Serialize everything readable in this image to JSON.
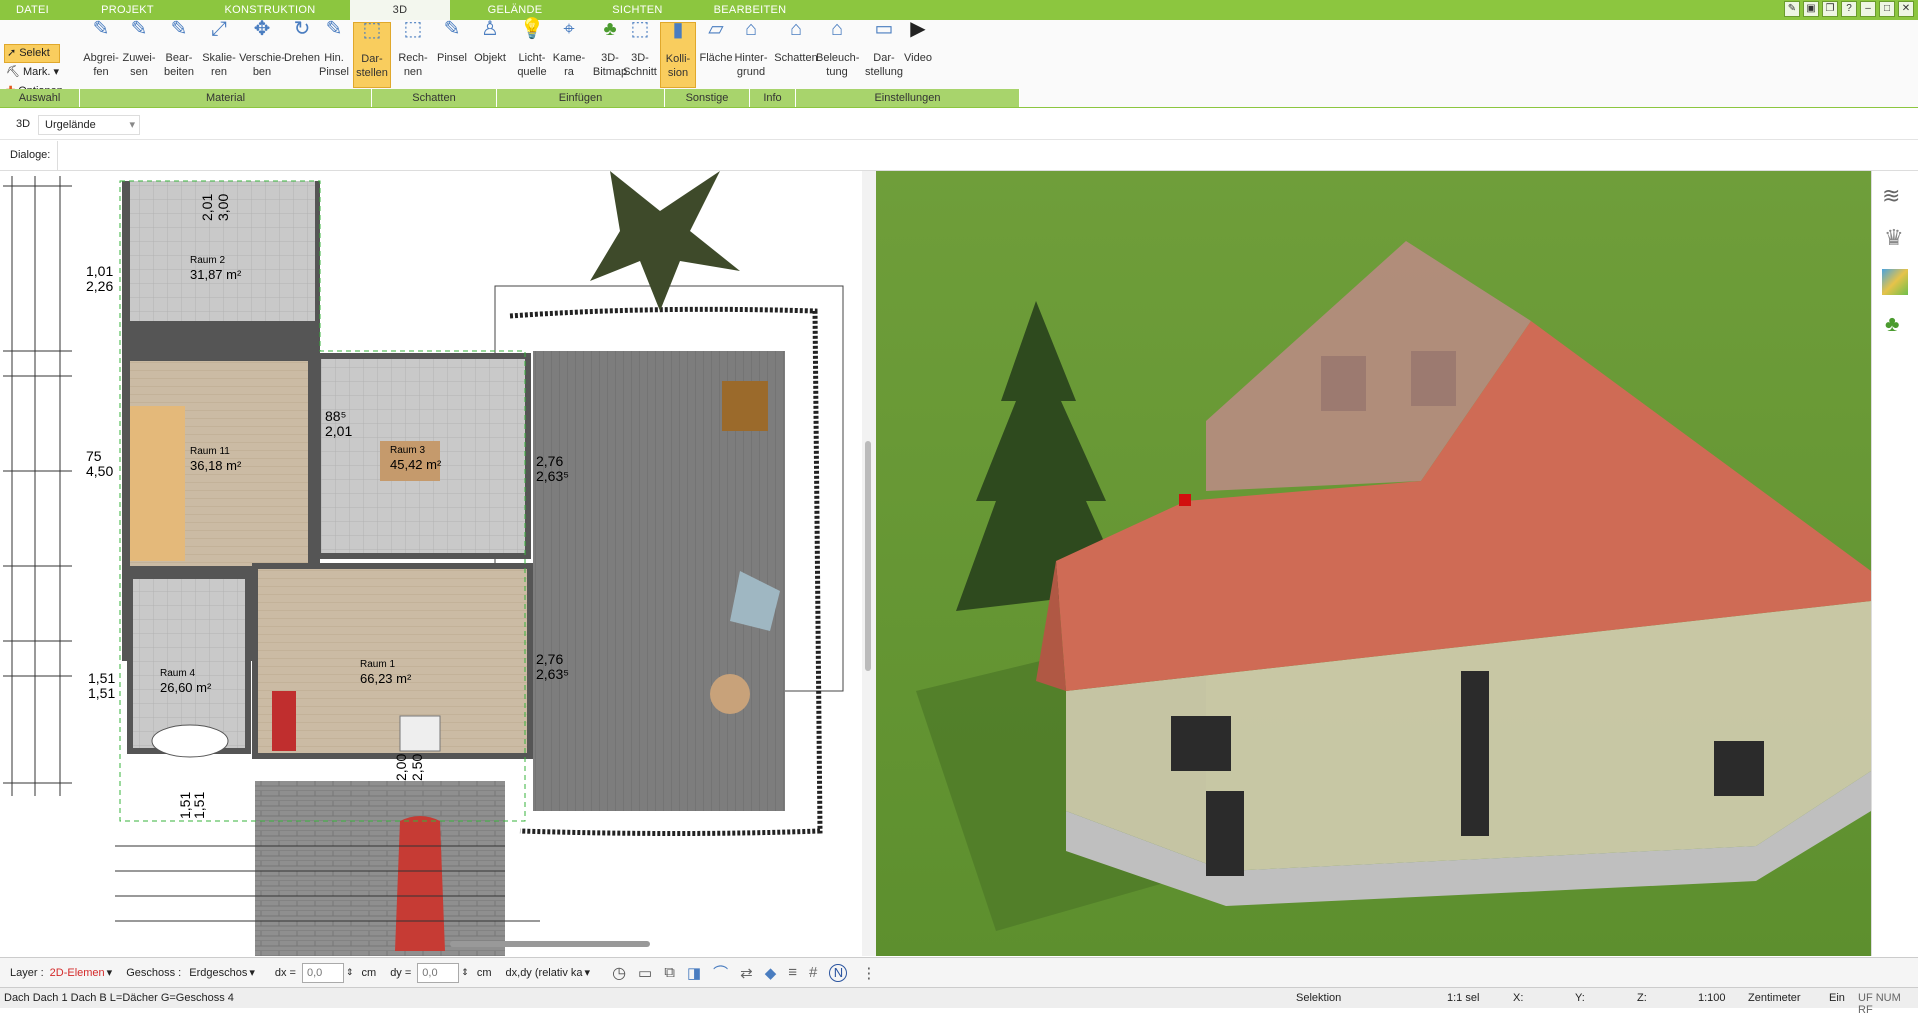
{
  "tabs": [
    "DATEI",
    "PROJEKT",
    "KONSTRUKTION",
    "3D",
    "GELÄNDE",
    "SICHTEN",
    "BEARBEITEN"
  ],
  "left_tools": {
    "select": "Selekt",
    "mark": "Mark.",
    "options": "Optionen"
  },
  "ribbon": {
    "buttons": [
      {
        "l1": "Abgrei-",
        "l2": "fen"
      },
      {
        "l1": "Zuwei-",
        "l2": "sen"
      },
      {
        "l1": "Bear-",
        "l2": "beiten"
      },
      {
        "l1": "Skalie-",
        "l2": "ren"
      },
      {
        "l1": "Verschie-",
        "l2": "ben"
      },
      {
        "l1": "Drehen",
        "l2": ""
      },
      {
        "l1": "Hin.",
        "l2": "Pinsel"
      },
      {
        "l1": "Dar-",
        "l2": "stellen"
      },
      {
        "l1": "Rech-",
        "l2": "nen"
      },
      {
        "l1": "Pinsel",
        "l2": ""
      },
      {
        "l1": "Objekt",
        "l2": ""
      },
      {
        "l1": "Licht-",
        "l2": "quelle"
      },
      {
        "l1": "Kame-",
        "l2": "ra"
      },
      {
        "l1": "3D-",
        "l2": "Bitmap"
      },
      {
        "l1": "3D-",
        "l2": "Schnitt"
      },
      {
        "l1": "Kolli-",
        "l2": "sion"
      },
      {
        "l1": "Fläche",
        "l2": ""
      },
      {
        "l1": "Hinter-",
        "l2": "grund"
      },
      {
        "l1": "Schatten",
        "l2": ""
      },
      {
        "l1": "Beleuch-",
        "l2": "tung"
      },
      {
        "l1": "Dar-",
        "l2": "stellung"
      },
      {
        "l1": "Video",
        "l2": ""
      }
    ],
    "groups": [
      "Auswahl",
      "Material",
      "Schatten",
      "Einfügen",
      "Sonstige",
      "Info",
      "Einstellungen"
    ]
  },
  "view_mode": "3D",
  "terrain_select": "Urgelände",
  "dialogs_label": "Dialoge:",
  "rooms": [
    {
      "name": "Raum 2",
      "area": "31,87 m²"
    },
    {
      "name": "Raum 11",
      "area": "36,18 m²"
    },
    {
      "name": "Raum 3",
      "area": "45,42 m²"
    },
    {
      "name": "Raum 4",
      "area": "26,60 m²"
    },
    {
      "name": "Raum 1",
      "area": "66,23 m²"
    }
  ],
  "dims": [
    "2,01",
    "3,00",
    "1,01",
    "2,26",
    "88⁵",
    "2,01",
    "75",
    "4,50",
    "88⁵",
    "2,01",
    "2,76",
    "2,63⁵",
    "88⁵",
    "2,01",
    "2,76",
    "2,63⁵",
    "1,51",
    "1,51",
    "2,00",
    "2,50",
    "1,51",
    "1,51"
  ],
  "toolbar": {
    "layer_label": "Layer :",
    "layer_value": "2D-Elemen",
    "floor_label": "Geschoss :",
    "floor_value": "Erdgeschos",
    "dx_label": "dx =",
    "dx_value": "0,0",
    "dx_unit": "cm",
    "dy_label": "dy =",
    "dy_value": "0,0",
    "dy_unit": "cm",
    "rel_value": "dx,dy (relativ ka"
  },
  "status": {
    "left": "Dach Dach 1 Dach B L=Dächer G=Geschoss 4",
    "mode": "Selektion",
    "sel": "1:1 sel",
    "x": "X:",
    "y": "Y:",
    "z": "Z:",
    "scale": "1:100",
    "unit": "Zentimeter",
    "ein": "Ein",
    "flags": "UF NUM RF"
  },
  "colors": {
    "accent": "#8cc63f",
    "group_bar": "#a8d46c",
    "highlight": "#f9cd5e",
    "roof": "#cf6b55",
    "grass": "#6fa03a"
  }
}
